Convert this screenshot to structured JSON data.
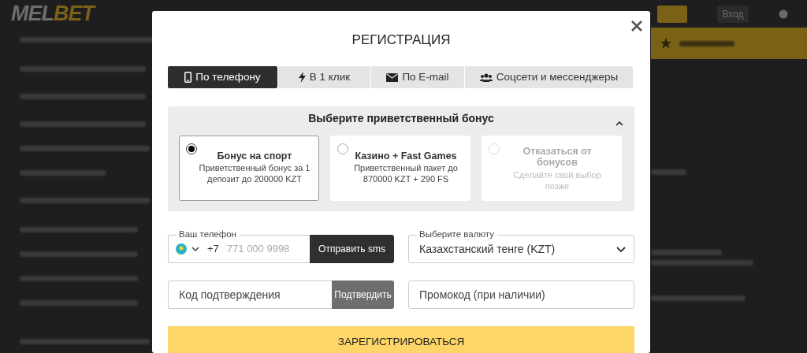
{
  "background_page": {
    "logo": {
      "part_1": "MEL",
      "part_2": "BET"
    },
    "login_button": "Вход"
  },
  "dialog": {
    "title": "РЕГИСТРАЦИЯ",
    "tabs": [
      {
        "label": "По телефону",
        "selected": true
      },
      {
        "label": "В 1 клик",
        "selected": false
      },
      {
        "label": "По E-mail",
        "selected": false
      },
      {
        "label": "Соцсети и мессенджеры",
        "selected": false
      }
    ],
    "bonus": {
      "title": "Выберите приветственный бонус",
      "expanded": true,
      "options": [
        {
          "title": "Бонус на спорт",
          "description": "Приветственный бонус за 1 депозит до 200000 KZT",
          "selected": true,
          "disabled": false
        },
        {
          "title": "Казино + Fast Games",
          "description": "Приветственный пакет до 870000 KZT + 290 FS",
          "selected": false,
          "disabled": false
        },
        {
          "title": "Отказаться от бонусов",
          "description": "Сделайте свой выбор позже",
          "selected": false,
          "disabled": true
        }
      ]
    },
    "phone": {
      "label": "Ваш телефон",
      "code": "+7",
      "placeholder": "771 000 9998",
      "button": "Отправить sms"
    },
    "currency": {
      "label": "Выберите валюту",
      "value": "Казахстанский тенге (KZT)"
    },
    "confirmation": {
      "placeholder": "Код подтверждения",
      "button": "Подтвердить"
    },
    "promo": {
      "placeholder": "Промокод (при наличии)"
    },
    "register_button": "ЗАРЕГИСТРИРОВАТЬСЯ"
  }
}
